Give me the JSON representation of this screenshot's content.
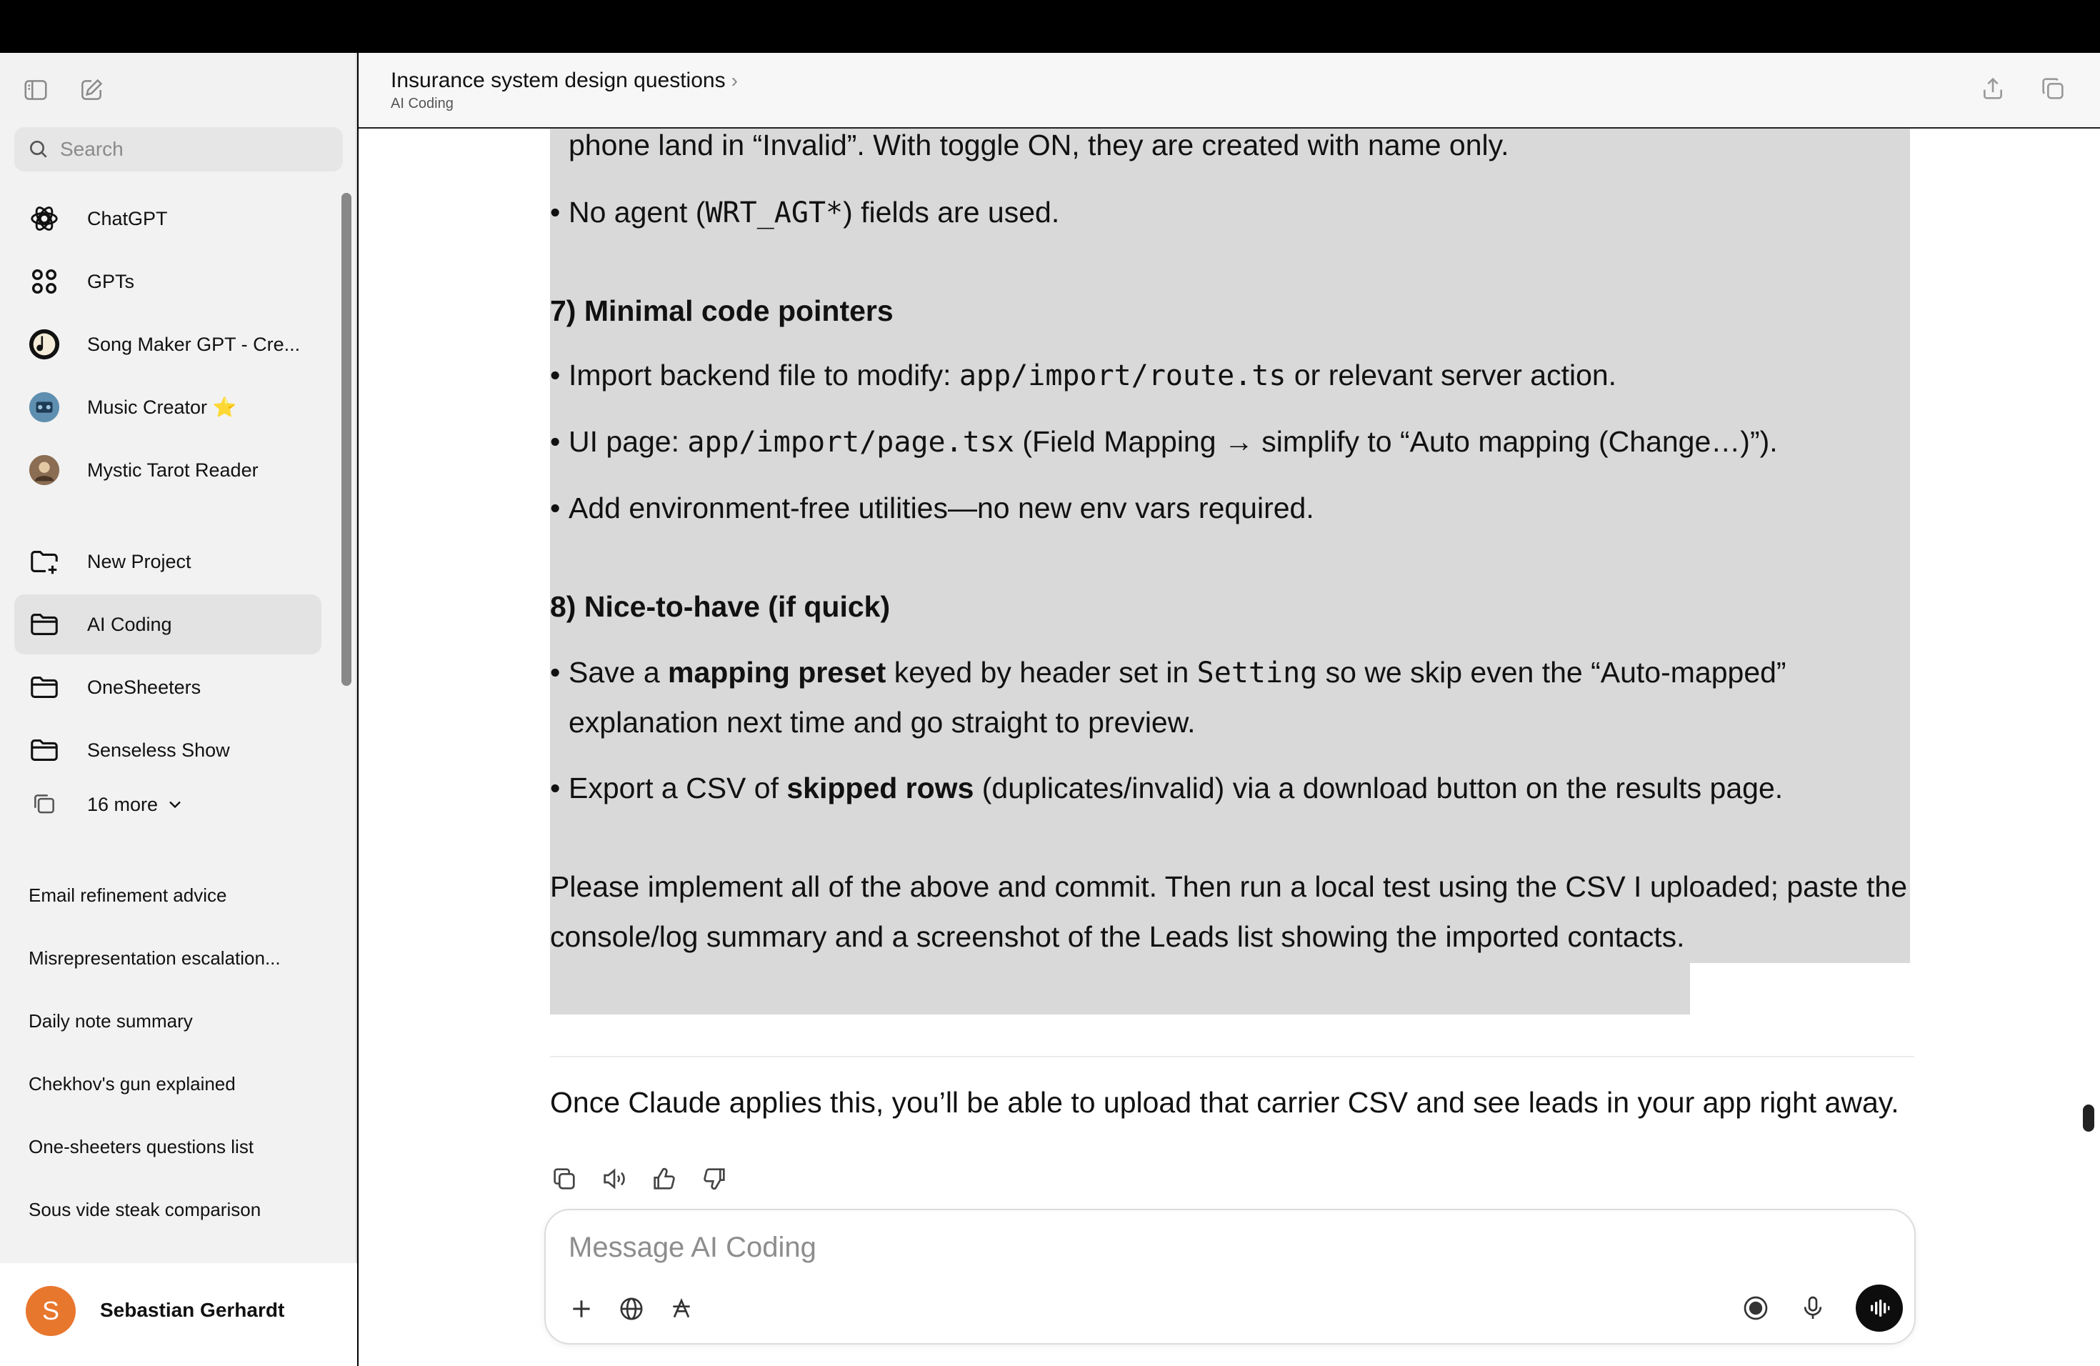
{
  "sidebar": {
    "search_placeholder": "Search",
    "gpts": [
      {
        "label": "ChatGPT",
        "icon": "openai-logo-icon"
      },
      {
        "label": "GPTs",
        "icon": "grid-icon"
      },
      {
        "label": "Song Maker GPT - Cre...",
        "icon": "song-maker-avatar"
      },
      {
        "label": "Music Creator ⭐",
        "icon": "music-creator-avatar"
      },
      {
        "label": "Mystic Tarot Reader",
        "icon": "tarot-avatar"
      }
    ],
    "projects": [
      {
        "label": "New Project",
        "icon": "new-folder-icon"
      },
      {
        "label": "AI Coding",
        "icon": "folder-icon"
      },
      {
        "label": "OneSheeters",
        "icon": "folder-icon"
      },
      {
        "label": "Senseless Show",
        "icon": "folder-icon"
      }
    ],
    "more_label": "16 more",
    "chats": [
      "Email refinement advice",
      "Misrepresentation escalation...",
      "Daily note summary",
      "Chekhov's gun explained",
      "One-sheeters questions list",
      "Sous vide steak comparison"
    ],
    "user": {
      "initial": "S",
      "name": "Sebastian Gerhardt",
      "avatar_color": "#e8772e"
    }
  },
  "header": {
    "title": "Insurance system design questions",
    "chevron": "›",
    "subtitle": "AI Coding"
  },
  "message": {
    "l1": "phone land in “Invalid”. With toggle ON, they are created with name only.",
    "b1_pre": "No agent (",
    "b1_code": "WRT_AGT*",
    "b1_post": ") fields are used.",
    "h7": "7) Minimal code pointers",
    "b2_pre": "Import backend file to modify: ",
    "b2_code": "app/import/route.ts",
    "b2_post": " or relevant server action.",
    "b3_pre": "UI page: ",
    "b3_code": "app/import/page.tsx",
    "b3_post": " (Field Mapping → simplify to “Auto mapping (Change…)”).",
    "b4": "Add environment-free utilities—no new env vars required.",
    "h8": "8) Nice-to-have (if quick)",
    "b5_pre": "Save a ",
    "b5_bold": "mapping preset",
    "b5_mid": " keyed by header set in ",
    "b5_code": "Setting",
    "b5_post": " so we skip even the “Auto-mapped”",
    "b5_cont": "explanation next time and go straight to preview.",
    "b6_pre": "Export a CSV of ",
    "b6_bold": "skipped rows",
    "b6_post": " (duplicates/invalid) via a download button on the results page.",
    "p1": "Please implement all of the above and commit. Then run a local test using the CSV I uploaded; paste the",
    "p2": "console/log summary and a screenshot of the Leads list showing the imported contacts.",
    "closing": "Once Claude applies this, you’ll be able to upload that carrier CSV and see leads in your app right away."
  },
  "composer": {
    "placeholder": "Message AI Coding"
  },
  "colors": {
    "accent_avatar": "#e8772e",
    "selection": "#d9d9d9"
  }
}
